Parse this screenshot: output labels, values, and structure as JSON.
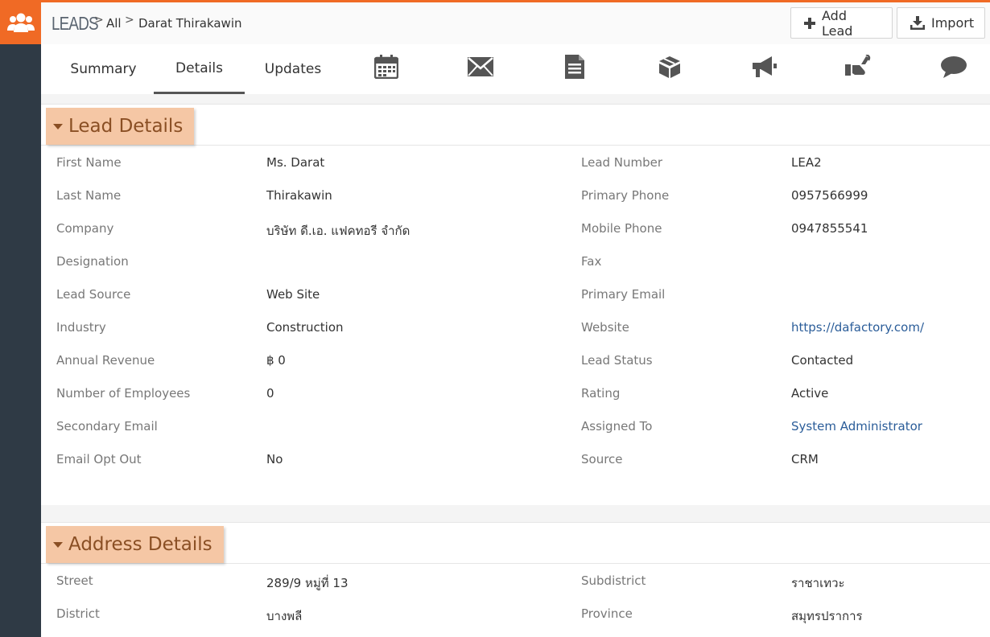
{
  "header": {
    "module_icon": "users-group-icon",
    "module": "LEADS",
    "crumb_sep": ">",
    "crumb_all": "All",
    "crumb_record": "Darat Thirakawin",
    "add_lead_label": "Add Lead",
    "import_label": "Import"
  },
  "tabs": {
    "summary": "Summary",
    "details": "Details",
    "updates": "Updates",
    "icons": [
      "calendar-icon",
      "envelope-icon",
      "document-icon",
      "box-icon",
      "megaphone-icon",
      "handshake-icon",
      "comment-icon"
    ]
  },
  "lead_details": {
    "title": "Lead Details",
    "left": [
      {
        "label": "First Name",
        "value": "Ms. Darat"
      },
      {
        "label": "Last Name",
        "value": "Thirakawin"
      },
      {
        "label": "Company",
        "value": "บริษัท ดี.เอ. แฟคทอรี จำกัด"
      },
      {
        "label": "Designation",
        "value": ""
      },
      {
        "label": "Lead Source",
        "value": "Web Site"
      },
      {
        "label": "Industry",
        "value": "Construction"
      },
      {
        "label": "Annual Revenue",
        "value": "฿ 0"
      },
      {
        "label": "Number of Employees",
        "value": "0"
      },
      {
        "label": "Secondary Email",
        "value": ""
      },
      {
        "label": "Email Opt Out",
        "value": "No"
      }
    ],
    "right": [
      {
        "label": "Lead Number",
        "value": "LEA2"
      },
      {
        "label": "Primary Phone",
        "value": "0957566999"
      },
      {
        "label": "Mobile Phone",
        "value": "0947855541"
      },
      {
        "label": "Fax",
        "value": ""
      },
      {
        "label": "Primary Email",
        "value": ""
      },
      {
        "label": "Website",
        "value": "https://dafactory.com/"
      },
      {
        "label": "Lead Status",
        "value": "Contacted"
      },
      {
        "label": "Rating",
        "value": "Active"
      },
      {
        "label": "Assigned To",
        "value": "System Administrator"
      },
      {
        "label": "Source",
        "value": "CRM"
      }
    ]
  },
  "address_details": {
    "title": "Address Details",
    "left": [
      {
        "label": "Street",
        "value": "289/9 หมู่ที่ 13"
      },
      {
        "label": "District",
        "value": "บางพลี"
      }
    ],
    "right": [
      {
        "label": "Subdistrict",
        "value": "ราชาเทวะ"
      },
      {
        "label": "Province",
        "value": "สมุทรปราการ"
      }
    ]
  },
  "colors": {
    "accent_orange": "#f06a25",
    "sidebar": "#2f3a45",
    "block_title_bg": "#f5c7a5",
    "block_title_text": "#8a4f24",
    "link": "#2b5d99"
  }
}
